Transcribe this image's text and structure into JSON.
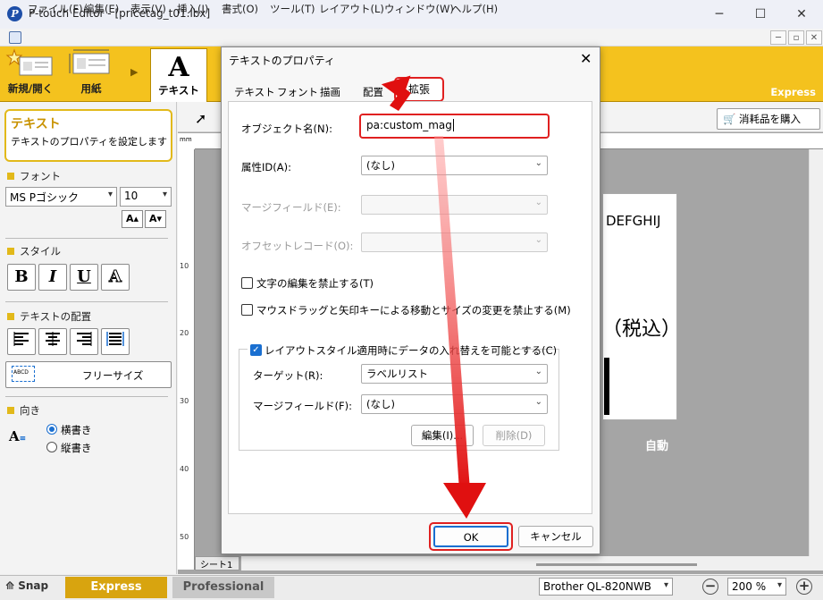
{
  "window": {
    "title": "P-touch Editor - [pricetag_t01.lbx]",
    "minimize": "─",
    "maximize": "☐",
    "close": "✕"
  },
  "menu": {
    "items": [
      "ファイル(F)",
      "編集(E)",
      "表示(V)",
      "挿入(I)",
      "書式(O)",
      "ツール(T)",
      "レイアウト(L)",
      "ウィンドウ(W)",
      "ヘルプ(H)"
    ]
  },
  "mdi_controls": [
    "─",
    "▫",
    "✕"
  ],
  "ribbon": {
    "new_open": "新規/開く",
    "paper": "用紙",
    "text": "テキスト",
    "text_glyph": "A",
    "mode_label": "Express"
  },
  "sidebar": {
    "title": "テキスト",
    "description": "テキストのプロパティを設定します",
    "font_section": "フォント",
    "font_name": "MS Pゴシック",
    "font_size": "10",
    "style_section": "スタイル",
    "style_buttons": [
      "B",
      "I",
      "U",
      "A"
    ],
    "align_section": "テキストの配置",
    "free_size": "フリーサイズ",
    "free_size_icon_text": "ABCD",
    "direction_section": "向き",
    "horizontal": "横書き",
    "vertical": "縦書き"
  },
  "canvas": {
    "buy_supplies": "消耗品を購入",
    "ruler_unit": "mm",
    "ruler_labels": [
      "10",
      "20",
      "30",
      "40",
      "50"
    ],
    "label_text_1": "DEFGHIJ",
    "label_text_2": "（税込）",
    "auto": "自動",
    "sheet_tab": "シート1"
  },
  "status": {
    "snap": "Snap",
    "express": "Express",
    "professional": "Professional",
    "printer": "Brother QL-820NWB",
    "zoom": "200 %"
  },
  "dialog": {
    "title": "テキストのプロパティ",
    "tabs": [
      "テキスト",
      "フォント",
      "描画",
      "配置",
      "拡張"
    ],
    "object_name_label": "オブジェクト名(N):",
    "object_name_value": "pa:custom_mag",
    "attr_id_label": "属性ID(A):",
    "attr_id_value": "(なし)",
    "merge_field_label": "マージフィールド(E):",
    "offset_record_label": "オフセットレコード(O):",
    "no_edit_text": "文字の編集を禁止する(T)",
    "no_move_resize": "マウスドラッグと矢印キーによる移動とサイズの変更を禁止する(M)",
    "allow_replace": "レイアウトスタイル適用時にデータの入れ替えを可能とする(C)",
    "target_label": "ターゲット(R):",
    "target_value": "ラベルリスト",
    "merge_field2_label": "マージフィールド(F):",
    "merge_field2_value": "(なし)",
    "edit_button": "編集(I)...",
    "delete_button": "削除(D)",
    "ok_button": "OK",
    "cancel_button": "キャンセル"
  },
  "colors": {
    "accent_yellow": "#f4c21e",
    "highlight_red": "#e02020",
    "focus_blue": "#1a6fd0"
  }
}
